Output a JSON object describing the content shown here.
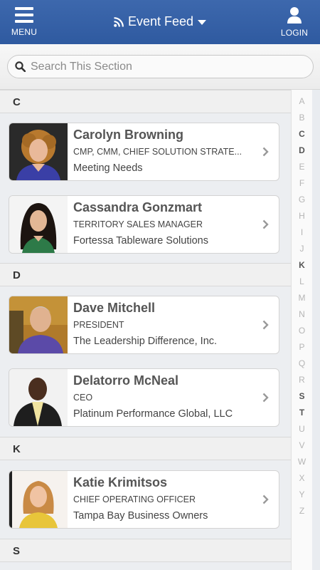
{
  "header": {
    "menu_label": "MENU",
    "title": "Event Feed",
    "login_label": "LOGIN",
    "bg_color": "#2f5aa0"
  },
  "search": {
    "placeholder": "Search This Section"
  },
  "sections": [
    {
      "letter": "C",
      "people": [
        {
          "name": "Carolyn Browning",
          "title": "CMP, CMM, CHIEF SOLUTION STRATE...",
          "company": "Meeting Needs"
        },
        {
          "name": "Cassandra Gonzmart",
          "title": "TERRITORY SALES MANAGER",
          "company": "Fortessa Tableware Solutions"
        }
      ]
    },
    {
      "letter": "D",
      "people": [
        {
          "name": "Dave Mitchell",
          "title": "PRESIDENT",
          "company": "The Leadership Difference, Inc."
        },
        {
          "name": "Delatorro McNeal",
          "title": "CEO",
          "company": "Platinum Performance Global, LLC"
        }
      ]
    },
    {
      "letter": "K",
      "people": [
        {
          "name": "Katie Krimitsos",
          "title": "CHIEF OPERATING OFFICER",
          "company": "Tampa Bay Business Owners"
        }
      ]
    },
    {
      "letter": "S",
      "people": []
    }
  ],
  "alpha_index": {
    "letters": [
      "A",
      "B",
      "C",
      "D",
      "E",
      "F",
      "G",
      "H",
      "I",
      "J",
      "K",
      "L",
      "M",
      "N",
      "O",
      "P",
      "Q",
      "R",
      "S",
      "T",
      "U",
      "V",
      "W",
      "X",
      "Y",
      "Z"
    ],
    "active": [
      "C",
      "D",
      "K",
      "S",
      "T"
    ]
  }
}
